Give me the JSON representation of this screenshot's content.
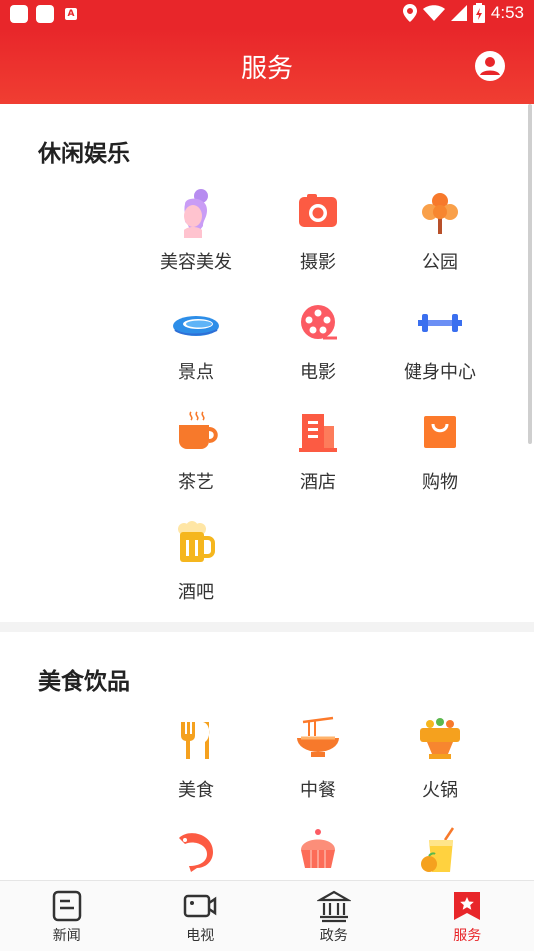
{
  "status_bar": {
    "time": "4:53",
    "notif_letter": "A"
  },
  "header": {
    "title": "服务"
  },
  "sections": [
    {
      "title": "休闲娱乐",
      "items": [
        {
          "label": "美容美发",
          "icon": "beauty-icon"
        },
        {
          "label": "摄影",
          "icon": "camera-icon"
        },
        {
          "label": "公园",
          "icon": "tree-icon"
        },
        {
          "label": "景点",
          "icon": "scenic-icon"
        },
        {
          "label": "电影",
          "icon": "film-reel-icon"
        },
        {
          "label": "健身中心",
          "icon": "dumbbell-icon"
        },
        {
          "label": "茶艺",
          "icon": "tea-cup-icon"
        },
        {
          "label": "酒店",
          "icon": "hotel-icon"
        },
        {
          "label": "购物",
          "icon": "shopping-bag-icon"
        },
        {
          "label": "酒吧",
          "icon": "beer-icon"
        }
      ]
    },
    {
      "title": "美食饮品",
      "items": [
        {
          "label": "美食",
          "icon": "fork-knife-icon"
        },
        {
          "label": "中餐",
          "icon": "noodle-bowl-icon"
        },
        {
          "label": "火锅",
          "icon": "hotpot-icon"
        },
        {
          "label": "",
          "icon": "shrimp-icon"
        },
        {
          "label": "",
          "icon": "cupcake-icon"
        },
        {
          "label": "",
          "icon": "juice-icon"
        }
      ]
    }
  ],
  "tabs": [
    {
      "label": "新闻",
      "icon": "news-icon",
      "active": false
    },
    {
      "label": "电视",
      "icon": "tv-camera-icon",
      "active": false
    },
    {
      "label": "政务",
      "icon": "government-icon",
      "active": false
    },
    {
      "label": "服务",
      "icon": "service-bookmark-icon",
      "active": true
    }
  ],
  "colors": {
    "brand_red": "#e8262a",
    "icon_orange": "#f7792b",
    "icon_yellow": "#f5b61e"
  }
}
